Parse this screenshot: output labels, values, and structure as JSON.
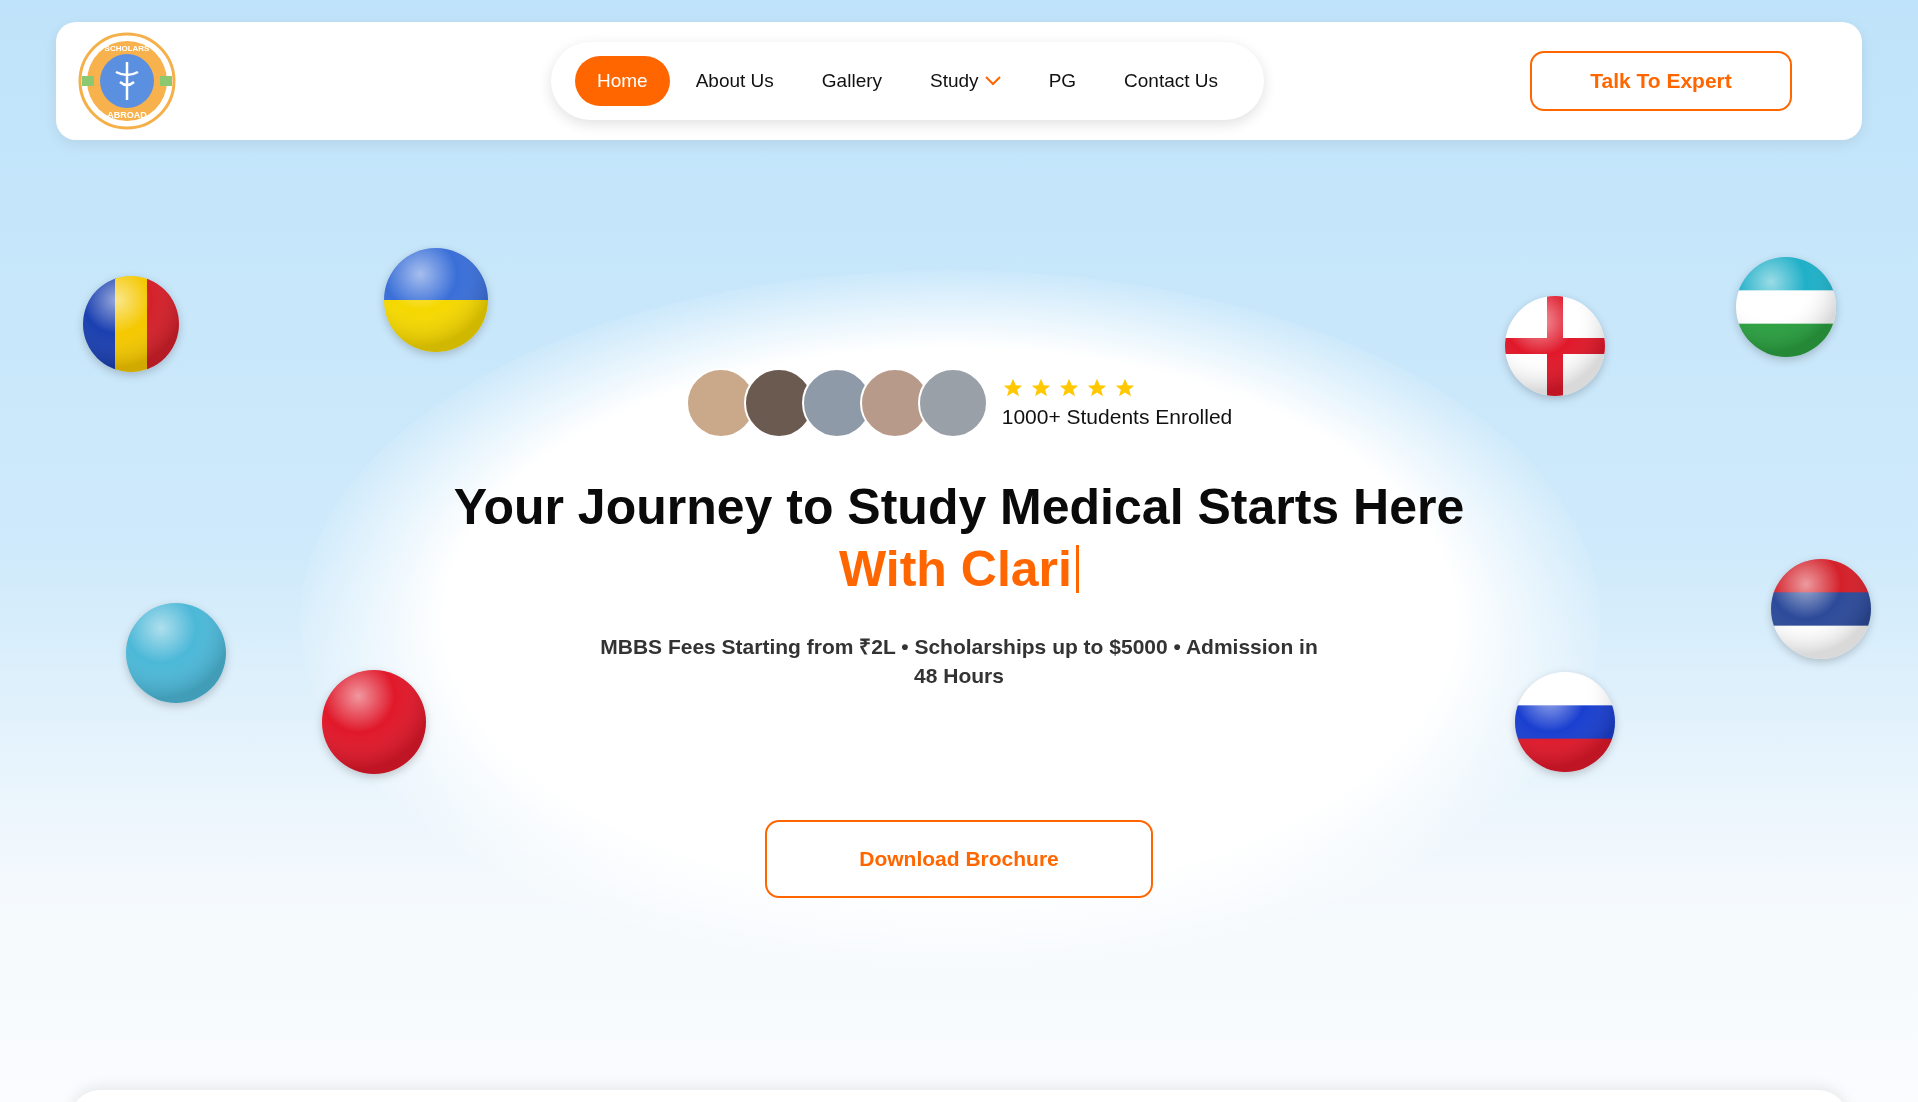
{
  "header": {
    "logo": {
      "top_text": "SCHOLARS",
      "bottom_text": "ABROAD"
    },
    "nav": [
      {
        "label": "Home",
        "selected": true,
        "dropdown": false
      },
      {
        "label": "About Us",
        "selected": false,
        "dropdown": false
      },
      {
        "label": "Gallery",
        "selected": false,
        "dropdown": false
      },
      {
        "label": "Study",
        "selected": false,
        "dropdown": true
      },
      {
        "label": "PG",
        "selected": false,
        "dropdown": false
      },
      {
        "label": "Contact Us",
        "selected": false,
        "dropdown": false
      }
    ],
    "cta": "Talk To Expert"
  },
  "hero": {
    "rating": {
      "stars": 5,
      "caption": "1000+ Students Enrolled"
    },
    "title": "Your Journey to Study Medical Starts Here",
    "typed": "With Clari",
    "subtitle": "MBBS Fees Starting from ₹2L • Scholarships up to $5000 • Admission in 48 Hours",
    "button": "Download Brochure"
  }
}
